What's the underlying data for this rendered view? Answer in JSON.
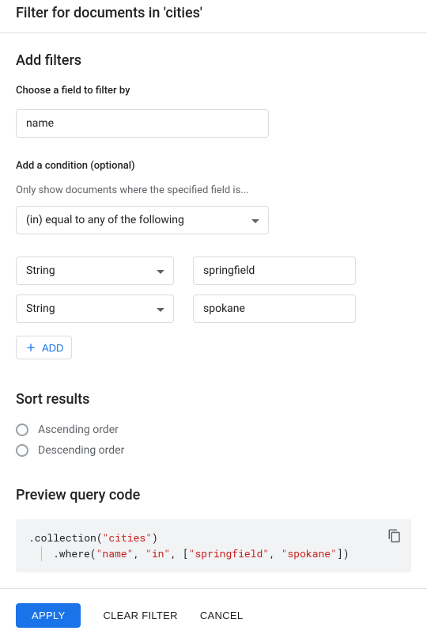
{
  "header": {
    "title": "Filter for documents in 'cities'"
  },
  "filters": {
    "section_title": "Add filters",
    "field_label": "Choose a field to filter by",
    "field_value": "name",
    "condition_label": "Add a condition (optional)",
    "condition_helper": "Only show documents where the specified field is...",
    "condition_operator": "(in) equal to any of the following",
    "rows": [
      {
        "type": "String",
        "value": "springfield"
      },
      {
        "type": "String",
        "value": "spokane"
      }
    ],
    "add_button": "ADD"
  },
  "sort": {
    "section_title": "Sort results",
    "options": [
      "Ascending order",
      "Descending order"
    ]
  },
  "preview": {
    "section_title": "Preview query code",
    "code": {
      "line1_pre": "  .collection(",
      "line1_str": "\"cities\"",
      "line1_post": ")",
      "line2_pre": ".where(",
      "line2_s1": "\"name\"",
      "line2_c1": ", ",
      "line2_s2": "\"in\"",
      "line2_c2": ", [",
      "line2_s3": "\"springfield\"",
      "line2_c3": ", ",
      "line2_s4": "\"spokane\"",
      "line2_post": "])"
    }
  },
  "footer": {
    "apply": "APPLY",
    "clear": "CLEAR FILTER",
    "cancel": "CANCEL"
  }
}
